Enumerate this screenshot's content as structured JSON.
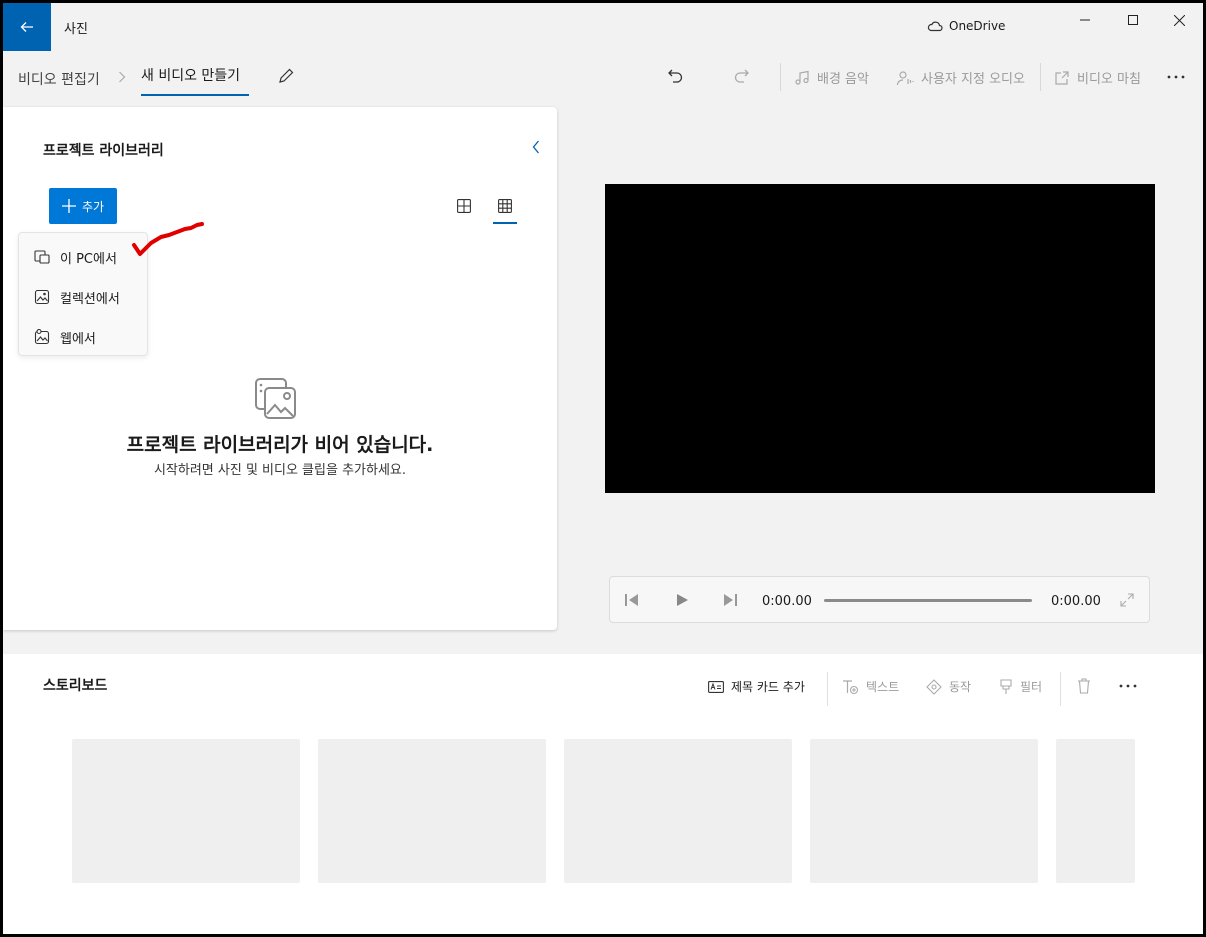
{
  "window": {
    "app_title": "사진",
    "onedrive_label": "OneDrive"
  },
  "breadcrumb": {
    "root": "비디오 편집기",
    "separator": ">",
    "current": "새 비디오 만들기"
  },
  "toolbar": {
    "background_music": "배경 음악",
    "custom_audio": "사용자 지정 오디오",
    "finish_video": "비디오 마침"
  },
  "library": {
    "title": "프로젝트 라이브러리",
    "add_label": "추가",
    "menu": [
      {
        "label": "이 PC에서",
        "icon": "pc-icon"
      },
      {
        "label": "컬렉션에서",
        "icon": "collection-icon"
      },
      {
        "label": "웹에서",
        "icon": "web-icon"
      }
    ],
    "empty_title": "프로젝트 라이브러리가 비어 있습니다.",
    "empty_subtitle": "시작하려면 사진 및 비디오 클립을 추가하세요."
  },
  "player": {
    "current_time": "0:00.00",
    "total_time": "0:00.00",
    "progress": 0
  },
  "storyboard": {
    "title": "스토리보드",
    "add_title_card": "제목 카드 추가",
    "text": "텍스트",
    "motion": "동작",
    "filters": "필터"
  },
  "colors": {
    "accent": "#0078d7",
    "titlebar_back": "#0063b1",
    "annotation": "#e00000"
  }
}
